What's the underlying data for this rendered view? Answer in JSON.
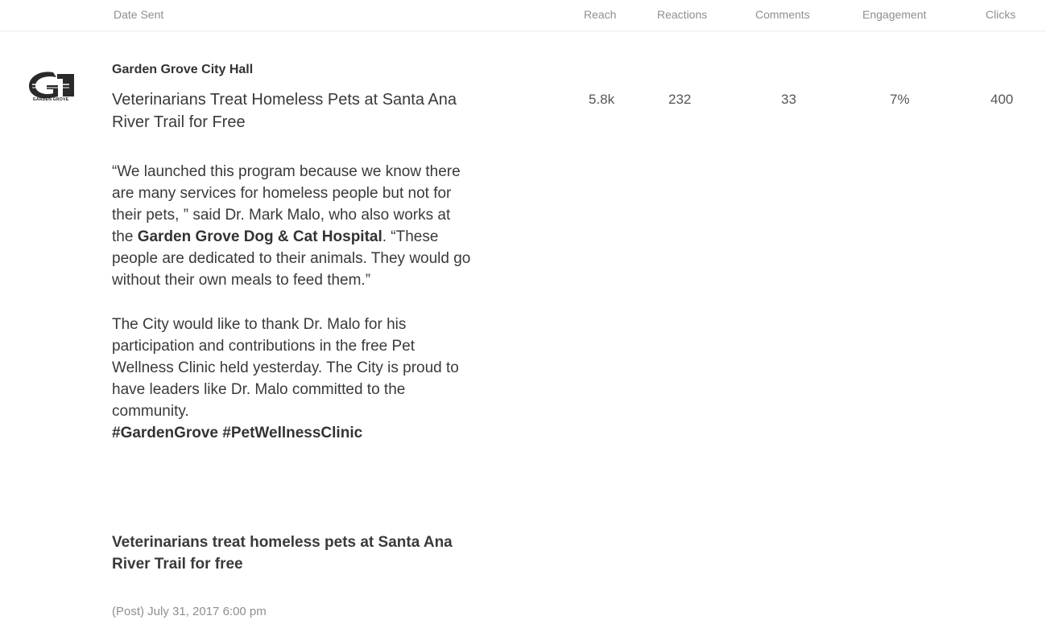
{
  "table_header": {
    "date_sent": "Date Sent",
    "reach": "Reach",
    "reactions": "Reactions",
    "comments": "Comments",
    "engagement": "Engagement",
    "clicks": "Clicks"
  },
  "post": {
    "logo_icon": "garden-grove-g-logo-icon",
    "logo_caption": "GARDEN GROVE",
    "page_name": "Garden Grove City Hall",
    "title": "Veterinarians Treat Homeless Pets at Santa Ana River Trail for Free",
    "body": {
      "p1_a": "“We launched this program because we know there are many services for homeless people but not for their pets, ” said Dr. Mark Malo, who also works at the ",
      "p1_bold": "Garden Grove Dog & Cat Hospital",
      "p1_b": ". “These people are dedicated to their animals. They would go without their own meals to feed them.”",
      "p2": "The City would like to thank Dr. Malo for his participation and contributions in the free Pet Wellness Clinic held yesterday. The City is proud to have leaders like Dr. Malo committed to the community.",
      "hashtags": "#GardenGrove #PetWellnessClinic"
    },
    "link_title": "Veterinarians treat homeless pets at Santa Ana River Trail for free",
    "date": "(Post) July 31, 2017 6:00 pm",
    "metrics": {
      "reach": "5.8k",
      "reactions": "232",
      "comments": "33",
      "engagement": "7%",
      "clicks": "400"
    }
  }
}
